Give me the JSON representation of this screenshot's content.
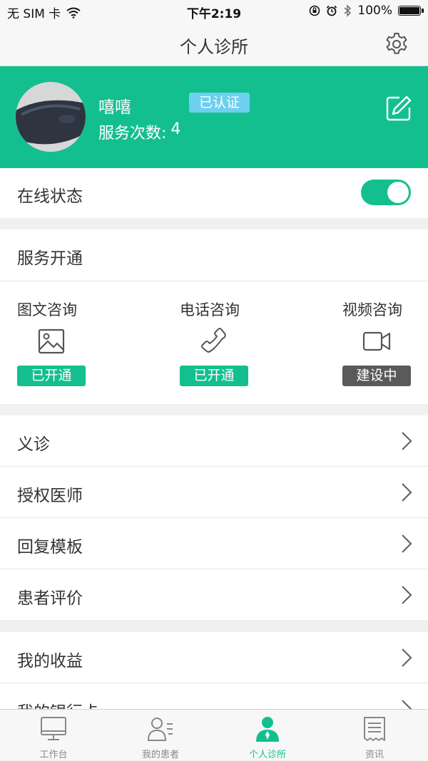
{
  "status_bar": {
    "carrier": "无 SIM 卡",
    "time": "下午2:19",
    "battery": "100%",
    "battery_level": 1.0
  },
  "nav": {
    "title": "个人诊所",
    "settings_icon": "gear-icon"
  },
  "profile": {
    "name": "嘻嘻",
    "verified_badge": "已认证",
    "service_count_label": "服务次数:",
    "service_count_value": "4",
    "edit_icon": "edit-icon",
    "colors": {
      "brand": "#13bf8f",
      "badge": "#6dd0ee"
    }
  },
  "online_status": {
    "label": "在线状态",
    "enabled": true
  },
  "service_activation": {
    "title": "服务开通",
    "items": [
      {
        "label": "图文咨询",
        "icon": "image-icon",
        "status": "已开通",
        "status_color": "#13bf8f"
      },
      {
        "label": "电话咨询",
        "icon": "phone-icon",
        "status": "已开通",
        "status_color": "#13bf8f"
      },
      {
        "label": "视频咨询",
        "icon": "video-icon",
        "status": "建设中",
        "status_color": "#5a5a5a"
      }
    ]
  },
  "menu_group_1": [
    {
      "label": "义诊"
    },
    {
      "label": "授权医师"
    },
    {
      "label": "回复模板"
    },
    {
      "label": "患者评价"
    }
  ],
  "menu_group_2": [
    {
      "label": "我的收益"
    },
    {
      "label": "我的银行卡"
    }
  ],
  "tabbar": {
    "items": [
      {
        "label": "工作台",
        "icon": "monitor-icon",
        "active": false
      },
      {
        "label": "我的患者",
        "icon": "patients-icon",
        "active": false
      },
      {
        "label": "个人诊所",
        "icon": "doctor-icon",
        "active": true
      },
      {
        "label": "资讯",
        "icon": "news-icon",
        "active": false
      }
    ],
    "active_color": "#13bf8f"
  }
}
